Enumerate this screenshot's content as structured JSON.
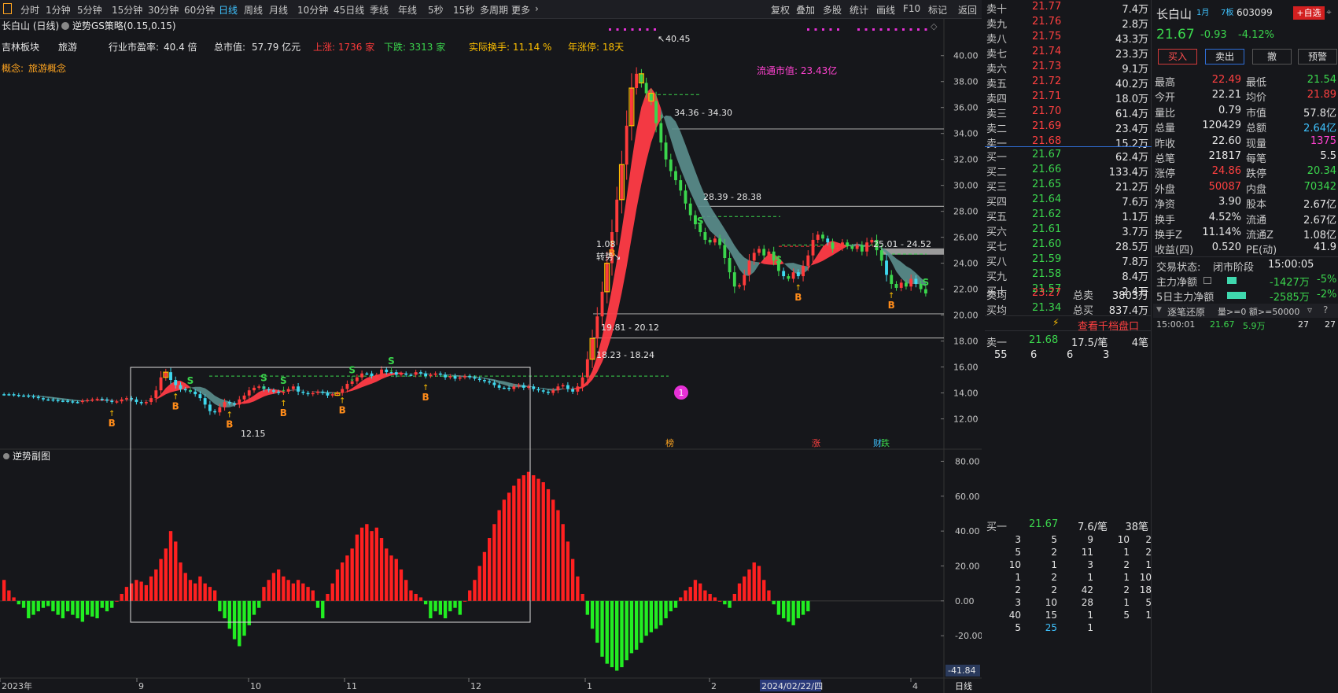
{
  "toolbar": {
    "periods": [
      "分时",
      "1分钟",
      "5分钟",
      "15分钟",
      "30分钟",
      "60分钟",
      "日线",
      "周线",
      "月线",
      "10分钟",
      "45日线",
      "季线",
      "年线",
      "5秒",
      "15秒",
      "多周期",
      "更多"
    ],
    "active": "日线",
    "right": [
      "复权",
      "叠加",
      "多股",
      "统计",
      "画线",
      "F10",
      "标记",
      "返回"
    ]
  },
  "chart_header": {
    "title": "长白山 (日线)",
    "strategy": "逆势GS策略(0.15,0.15)",
    "info_row": {
      "board_label": "吉林板块",
      "board_value": "旅游",
      "pe_label": "行业市盈率:",
      "pe_value": "40.4 倍",
      "cap_label": "总市值:",
      "cap_value": "57.79 亿元",
      "up_text": "上涨: 1736 家",
      "down_text": "下跌: 3313 家",
      "turnover_text": "实际换手: 11.14 %",
      "limit_text": "年涨停: 18天"
    },
    "concept_label": "概念:",
    "concept_value": "旅游概念",
    "float_cap": "流通市值: 23.43亿"
  },
  "price_axis": [
    "40.00",
    "38.00",
    "36.00",
    "34.00",
    "32.00",
    "30.00",
    "28.00",
    "26.00",
    "24.00",
    "22.00",
    "20.00",
    "18.00",
    "16.00",
    "14.00",
    "12.00"
  ],
  "sub_axis": [
    "80.00",
    "60.00",
    "40.00",
    "20.00",
    "0.00",
    "-20.00"
  ],
  "sub_title": "逆势副图",
  "sub_current": "-41.84",
  "time_axis": [
    "2023年",
    "9",
    "10",
    "11",
    "12",
    "1",
    "2",
    "4"
  ],
  "cursor_date": "2024/02/22/四",
  "period_tag": "日线",
  "chart_labels": {
    "high": "40.45",
    "low": "12.15",
    "level1": "34.36 - 34.30",
    "level2": "28.39 - 28.38",
    "level3": "25.01 - 24.52",
    "level4": "19.81 - 20.12",
    "level5": "18.23 - 18.24",
    "turn_value": "1.08",
    "turn_text": "转势↘",
    "event_num": "1",
    "tag_bang": "榜",
    "tag_zhang": "涨",
    "tag_cai": "财",
    "tag_die": "跌",
    "buy": "B",
    "sell": "S"
  },
  "chart_data": {
    "type": "candlestick",
    "price_range": [
      11,
      41.5
    ],
    "indicator_range": [
      -42,
      82
    ],
    "price": [
      13.9,
      13.9,
      13.85,
      13.8,
      13.8,
      13.75,
      13.7,
      13.6,
      13.5,
      13.5,
      13.45,
      13.4,
      13.4,
      13.35,
      13.3,
      13.3,
      13.4,
      13.45,
      13.5,
      13.55,
      13.5,
      13.4,
      13.3,
      13.35,
      13.5,
      13.6,
      13.5,
      13.3,
      13.2,
      13.3,
      13.6,
      14.2,
      15.2,
      15.6,
      15.0,
      14.6,
      14.3,
      14.2,
      14.1,
      13.9,
      13.6,
      13.1,
      12.6,
      12.5,
      12.9,
      13.3,
      13.2,
      13.1,
      13.5,
      13.8,
      14.2,
      14.4,
      14.5,
      14.3,
      14.2,
      14.1,
      14.0,
      14.1,
      14.3,
      14.5,
      14.1,
      14.0,
      13.9,
      14.0,
      14.1,
      14.0,
      13.8,
      13.9,
      14.0,
      14.3,
      14.7,
      14.9,
      15.2,
      15.5,
      15.5,
      15.3,
      15.4,
      15.8,
      15.6,
      15.6,
      15.4,
      15.5,
      15.4,
      15.4,
      15.6,
      15.5,
      15.3,
      15.4,
      15.5,
      15.4,
      15.2,
      15.3,
      15.1,
      15.2,
      15.3,
      15.2,
      15.1,
      15.0,
      14.9,
      14.8,
      14.6,
      14.4,
      14.4,
      14.3,
      14.5,
      14.6,
      14.4,
      14.5,
      14.3,
      14.2,
      14.1,
      14.0,
      14.2,
      14.5,
      14.6,
      14.3,
      14.1,
      14.5,
      15.2,
      16.6,
      18.2,
      19.9,
      21.8,
      24.0,
      26.4,
      28.9,
      31.6,
      34.6,
      37.5,
      38.6,
      37.9,
      37.1,
      36.5,
      34.8,
      33.3,
      32.0,
      31.1,
      30.4,
      29.6,
      28.6,
      27.7,
      27.0,
      26.4,
      25.8,
      25.6,
      25.9,
      25.4,
      24.4,
      23.3,
      22.2,
      22.3,
      23.1,
      24.2,
      24.8,
      25.1,
      24.6,
      24.9,
      24.2,
      23.4,
      23.0,
      22.8,
      23.3,
      23.0,
      23.8,
      24.6,
      25.8,
      26.2,
      25.9,
      25.6,
      25.1,
      25.2,
      25.6,
      25.3,
      25.1,
      25.4,
      24.9,
      25.6,
      25.8,
      25.0,
      24.2,
      23.1,
      22.4,
      22.1,
      22.5,
      22.2,
      22.8,
      22.4,
      22.0,
      21.67
    ],
    "indicator": [
      12,
      6,
      2,
      -2,
      -4,
      -10,
      -8,
      -6,
      -4,
      -3,
      -6,
      -8,
      -10,
      -6,
      -8,
      -10,
      -12,
      -8,
      -9,
      -10,
      -4,
      -6,
      -4,
      0,
      4,
      8,
      10,
      12,
      11,
      9,
      14,
      18,
      24,
      30,
      40,
      34,
      22,
      16,
      12,
      10,
      14,
      10,
      8,
      6,
      -6,
      -10,
      -16,
      -22,
      -26,
      -20,
      -14,
      -8,
      -4,
      8,
      12,
      16,
      18,
      14,
      12,
      10,
      12,
      10,
      8,
      6,
      -4,
      -10,
      4,
      10,
      18,
      22,
      26,
      30,
      38,
      42,
      44,
      40,
      42,
      36,
      30,
      26,
      24,
      18,
      12,
      6,
      4,
      2,
      -2,
      -10,
      -6,
      -8,
      -10,
      -6,
      -4,
      -8,
      0,
      6,
      12,
      20,
      28,
      36,
      44,
      52,
      58,
      62,
      66,
      70,
      72,
      74,
      72,
      70,
      68,
      64,
      58,
      52,
      44,
      34,
      24,
      14,
      4,
      -8,
      -16,
      -24,
      -32,
      -36,
      -38,
      -40,
      -38,
      -34,
      -30,
      -28,
      -24,
      -20,
      -18,
      -16,
      -14,
      -10,
      -6,
      -4,
      2,
      6,
      8,
      12,
      10,
      6,
      4,
      2,
      0,
      -2,
      -4,
      4,
      10,
      14,
      18,
      22,
      20,
      12,
      6,
      -2,
      -8,
      -10,
      -12,
      -14,
      -10,
      -8,
      -6
    ]
  },
  "book": {
    "sells": [
      {
        "label": "卖十",
        "price": "21.77",
        "vol": "7.4万"
      },
      {
        "label": "卖九",
        "price": "21.76",
        "vol": "2.8万"
      },
      {
        "label": "卖八",
        "price": "21.75",
        "vol": "43.3万"
      },
      {
        "label": "卖七",
        "price": "21.74",
        "vol": "23.3万"
      },
      {
        "label": "卖六",
        "price": "21.73",
        "vol": "9.1万"
      },
      {
        "label": "卖五",
        "price": "21.72",
        "vol": "40.2万"
      },
      {
        "label": "卖四",
        "price": "21.71",
        "vol": "18.0万"
      },
      {
        "label": "卖三",
        "price": "21.70",
        "vol": "61.4万"
      },
      {
        "label": "卖二",
        "price": "21.69",
        "vol": "23.4万"
      },
      {
        "label": "卖一",
        "price": "21.68",
        "vol": "15.2万"
      }
    ],
    "buys": [
      {
        "label": "买一",
        "price": "21.67",
        "vol": "62.4万"
      },
      {
        "label": "买二",
        "price": "21.66",
        "vol": "133.4万"
      },
      {
        "label": "买三",
        "price": "21.65",
        "vol": "21.2万"
      },
      {
        "label": "买四",
        "price": "21.64",
        "vol": "7.6万"
      },
      {
        "label": "买五",
        "price": "21.62",
        "vol": "1.1万"
      },
      {
        "label": "买六",
        "price": "21.61",
        "vol": "3.7万"
      },
      {
        "label": "买七",
        "price": "21.60",
        "vol": "28.5万"
      },
      {
        "label": "买八",
        "price": "21.59",
        "vol": "7.8万"
      },
      {
        "label": "买九",
        "price": "21.58",
        "vol": "8.4万"
      },
      {
        "label": "买十",
        "price": "21.57",
        "vol": "2.4万"
      }
    ],
    "avg_sell_label": "卖均",
    "avg_sell": "23.27",
    "total_sell_label": "总卖",
    "total_sell": "3803万",
    "avg_buy_label": "买均",
    "avg_buy": "21.34",
    "total_buy_label": "总买",
    "total_buy": "837.4万",
    "depth_link": "查看千档盘口",
    "sell1_label": "卖一",
    "sell1_price": "21.68",
    "sell1_per": "17.5/笔",
    "sell1_count": "4笔",
    "sell1_orders": [
      "55",
      "6",
      "6",
      "3"
    ],
    "buy1_label": "买一",
    "buy1_price": "21.67",
    "buy1_per": "7.6/笔",
    "buy1_count": "38笔",
    "buy1_orders": [
      [
        "3",
        "5",
        "9",
        "10",
        "2"
      ],
      [
        "5",
        "2",
        "11",
        "1",
        "2"
      ],
      [
        "10",
        "1",
        "3",
        "2",
        "1"
      ],
      [
        "1",
        "2",
        "1",
        "1",
        "10"
      ],
      [
        "2",
        "2",
        "42",
        "2",
        "18"
      ],
      [
        "3",
        "10",
        "28",
        "1",
        "5"
      ],
      [
        "40",
        "15",
        "1",
        "5",
        "1"
      ],
      [
        "5",
        "25",
        "1",
        "",
        ""
      ]
    ]
  },
  "quote": {
    "name": "长白山",
    "tag1": "1月",
    "tag2": "7板",
    "code": "603099",
    "add_fav": "+自选",
    "price": "21.67",
    "change": "-0.93",
    "pct": "-4.12%",
    "buttons": [
      "买入",
      "卖出",
      "撤",
      "预警"
    ],
    "rows": [
      [
        "最高",
        "22.49",
        "最低",
        "21.54"
      ],
      [
        "今开",
        "22.21",
        "均价",
        "21.89"
      ],
      [
        "量比",
        "0.79",
        "市值",
        "57.8亿"
      ],
      [
        "总量",
        "120429",
        "总额",
        "2.64亿"
      ],
      [
        "昨收",
        "22.60",
        "现量",
        "1375"
      ],
      [
        "总笔",
        "21817",
        "每笔",
        "5.5"
      ],
      [
        "涨停",
        "24.86",
        "跌停",
        "20.34"
      ],
      [
        "外盘",
        "50087",
        "内盘",
        "70342"
      ],
      [
        "净资",
        "3.90",
        "股本",
        "2.67亿"
      ],
      [
        "换手",
        "4.52%",
        "流通",
        "2.67亿"
      ],
      [
        "换手Z",
        "11.14%",
        "流通Z",
        "1.08亿"
      ],
      [
        "收益(四)",
        "0.520",
        "PE(动)",
        "41.9"
      ]
    ],
    "trade_status_label": "交易状态:",
    "trade_status": "闭市阶段",
    "trade_time": "15:00:05",
    "main_flow_label": "主力净额",
    "main_flow": "-1427万",
    "main_flow_pct": "-5%",
    "main5_label": "5日主力净额",
    "main5": "-2585万",
    "main5_pct": "-2%",
    "tick_label": "逐笔还原",
    "tick_filter": "量>=0 额>=50000",
    "tick_time": "15:00:01",
    "tick_price": "21.67",
    "tick_vol": "5.9万",
    "tick_a": "27",
    "tick_b": "27"
  },
  "colors": {
    "up": "#ff3b3b",
    "down": "#3bd64d",
    "flat": "#3fd8ee",
    "ribbon_up": "#ff3b46",
    "ribbon_down": "#5b8f8e",
    "accent": "#3fc3ff"
  }
}
